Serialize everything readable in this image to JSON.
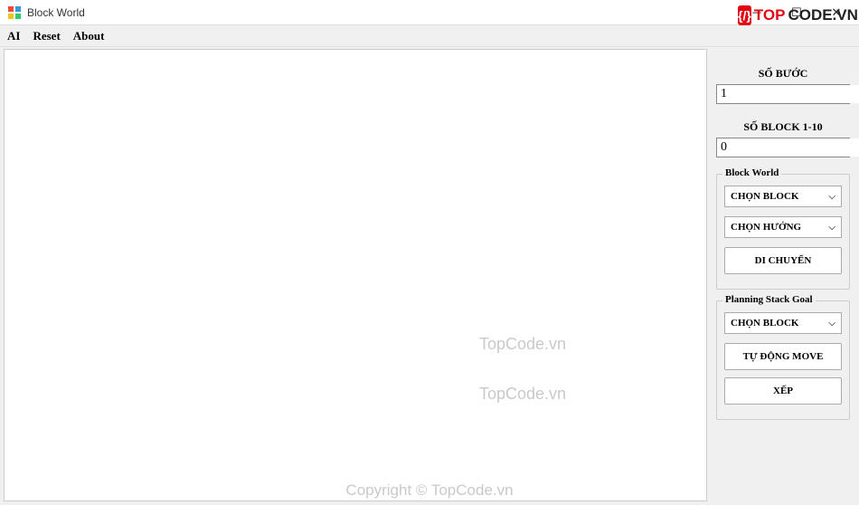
{
  "window": {
    "title": "Block World"
  },
  "menu": {
    "ai": "AI",
    "reset": "Reset",
    "about": "About"
  },
  "side": {
    "steps_label": "SỐ BƯỚC",
    "steps_value": "1",
    "blocks_label": "SỐ BLOCK 1-10",
    "blocks_value": "0"
  },
  "group_block": {
    "title": "Block World",
    "select_block": "CHỌN BLOCK",
    "select_dir": "CHỌN HƯỚNG",
    "move_btn": "DI CHUYỂN"
  },
  "group_plan": {
    "title": "Planning Stack Goal",
    "select_block": "CHỌN BLOCK",
    "auto_btn": "TỰ ĐỘNG MOVE",
    "sort_btn": "XẾP"
  },
  "watermarks": {
    "w1": "TopCode.vn",
    "w2": "TopCode.vn",
    "footer": "Copyright © TopCode.vn"
  },
  "logo": {
    "icon": "{/}",
    "red": "TOP",
    "dark": "CODE.VN"
  }
}
